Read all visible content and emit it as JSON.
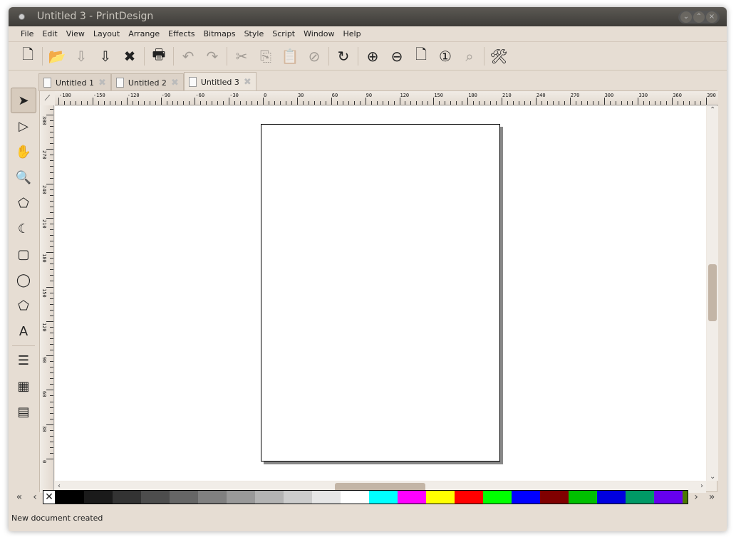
{
  "window": {
    "title": "Untitled 3 - PrintDesign"
  },
  "menu": [
    "File",
    "Edit",
    "View",
    "Layout",
    "Arrange",
    "Effects",
    "Bitmaps",
    "Style",
    "Script",
    "Window",
    "Help"
  ],
  "toolbar": [
    {
      "icon": "new-document-icon",
      "glyph": "🗋",
      "enabled": true
    },
    {
      "sep": true
    },
    {
      "icon": "open-folder-icon",
      "glyph": "📂",
      "enabled": true
    },
    {
      "icon": "save-icon",
      "glyph": "⇩",
      "enabled": false
    },
    {
      "icon": "save-as-icon",
      "glyph": "⇩",
      "enabled": true
    },
    {
      "icon": "close-document-icon",
      "glyph": "✖",
      "enabled": true
    },
    {
      "sep": true
    },
    {
      "icon": "print-icon",
      "glyph": "🖶",
      "enabled": true
    },
    {
      "sep": true
    },
    {
      "icon": "undo-icon",
      "glyph": "↶",
      "enabled": false
    },
    {
      "icon": "redo-icon",
      "glyph": "↷",
      "enabled": false
    },
    {
      "sep": true
    },
    {
      "icon": "cut-icon",
      "glyph": "✂",
      "enabled": false
    },
    {
      "icon": "copy-icon",
      "glyph": "⎘",
      "enabled": false
    },
    {
      "icon": "paste-icon",
      "glyph": "📋",
      "enabled": false
    },
    {
      "icon": "delete-icon",
      "glyph": "⊘",
      "enabled": false
    },
    {
      "sep": true
    },
    {
      "icon": "refresh-icon",
      "glyph": "↻",
      "enabled": true
    },
    {
      "sep": true
    },
    {
      "icon": "zoom-in-icon",
      "glyph": "⊕",
      "enabled": true
    },
    {
      "icon": "zoom-out-icon",
      "glyph": "⊖",
      "enabled": true
    },
    {
      "icon": "zoom-page-icon",
      "glyph": "🗋",
      "enabled": true
    },
    {
      "icon": "zoom-100-icon",
      "glyph": "①",
      "enabled": true
    },
    {
      "icon": "zoom-selected-icon",
      "glyph": "⌕",
      "enabled": false
    },
    {
      "sep": true
    },
    {
      "icon": "preferences-tools-icon",
      "glyph": "🛠",
      "enabled": true
    }
  ],
  "tabs": [
    {
      "label": "Untitled 1",
      "active": false
    },
    {
      "label": "Untitled 2",
      "active": false
    },
    {
      "label": "Untitled 3",
      "active": true
    }
  ],
  "tools": [
    {
      "icon": "select-arrow-icon",
      "glyph": "➤",
      "active": true
    },
    {
      "icon": "node-edit-icon",
      "glyph": "▷"
    },
    {
      "icon": "hand-pan-icon",
      "glyph": "✋"
    },
    {
      "icon": "zoom-tool-icon",
      "glyph": "🔍"
    },
    {
      "icon": "polyline-tool-icon",
      "glyph": "⬠"
    },
    {
      "icon": "bezier-tool-icon",
      "glyph": "☾"
    },
    {
      "icon": "rectangle-tool-icon",
      "glyph": "▢"
    },
    {
      "icon": "ellipse-tool-icon",
      "glyph": "◯"
    },
    {
      "icon": "polygon-tool-icon",
      "glyph": "⬠"
    },
    {
      "icon": "text-tool-icon",
      "glyph": "A"
    },
    {
      "sep": true
    },
    {
      "icon": "layers-panel-icon",
      "glyph": "☰"
    },
    {
      "icon": "color-panel-icon",
      "glyph": "▦"
    },
    {
      "icon": "gradient-panel-icon",
      "glyph": "▤"
    }
  ],
  "rulers": {
    "horizontal": [
      -180,
      -150,
      -120,
      -90,
      -60,
      -30,
      0,
      30,
      60,
      90,
      120,
      150,
      180,
      210,
      240,
      270,
      300,
      330,
      360,
      390
    ],
    "vertical": [
      300,
      270,
      240,
      210,
      180,
      150,
      120,
      90,
      60,
      30,
      0
    ]
  },
  "palette": [
    "#000000",
    "#1a1a1a",
    "#333333",
    "#4d4d4d",
    "#666666",
    "#808080",
    "#999999",
    "#b3b3b3",
    "#cccccc",
    "#e6e6e6",
    "#ffffff",
    "#00ffff",
    "#ff00ff",
    "#ffff00",
    "#ff0000",
    "#00ff00",
    "#0000ff",
    "#800000",
    "#00c000",
    "#0000e0",
    "#009966",
    "#6600ee"
  ],
  "status": "New document created"
}
